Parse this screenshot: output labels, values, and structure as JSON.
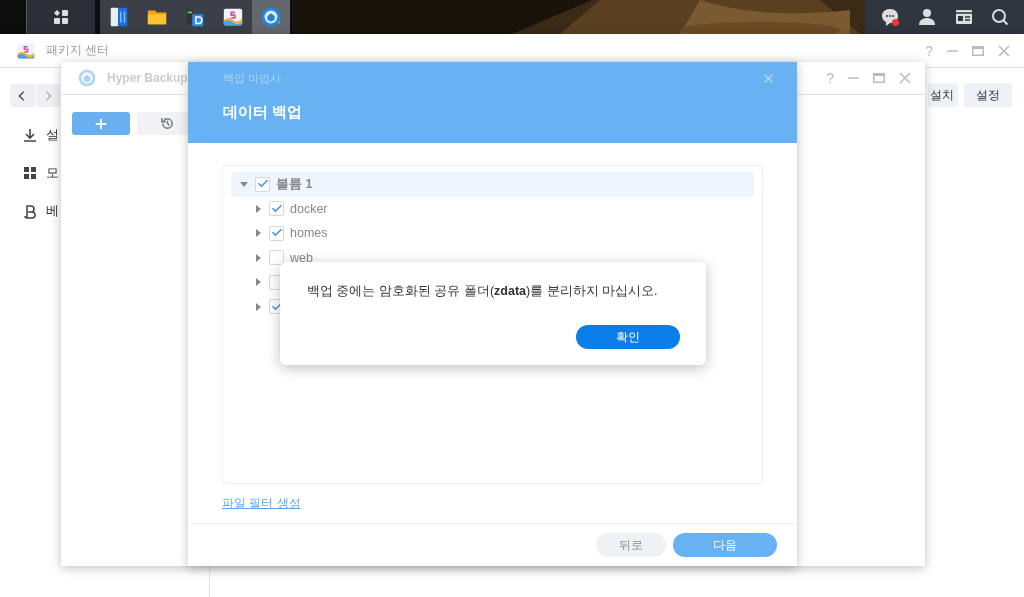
{
  "taskbar": {
    "apps": [
      {
        "kind": "storage",
        "selected": false
      },
      {
        "kind": "folder",
        "selected": false
      },
      {
        "kind": "docs",
        "selected": false
      },
      {
        "kind": "package",
        "selected": false
      },
      {
        "kind": "backup",
        "selected": true
      }
    ],
    "notifications": {
      "unread": true
    }
  },
  "package_center": {
    "title": "패키지 센터",
    "help": "?",
    "sidebar": [
      {
        "kind": "download",
        "label": "설"
      },
      {
        "kind": "grid",
        "label": "모"
      },
      {
        "kind": "beta",
        "label": "베"
      }
    ],
    "buttons": [
      "설치",
      "설정"
    ]
  },
  "hyper_backup": {
    "title": "Hyper Backup",
    "help": "?"
  },
  "wizard": {
    "title": "백업 마법사",
    "heading": "데이터 백업",
    "tree": [
      {
        "label": "볼륨 1",
        "checked": true,
        "expanded": true,
        "selected": true,
        "children": [
          {
            "label": "docker",
            "checked": true,
            "expanded": false,
            "selected": false
          },
          {
            "label": "homes",
            "checked": true,
            "expanded": false,
            "selected": false
          },
          {
            "label": "web",
            "checked": false,
            "expanded": false,
            "selected": false
          },
          {
            "checked": false,
            "expanded": false,
            "selected": false
          },
          {
            "checked": true,
            "expanded": false,
            "selected": false
          }
        ]
      }
    ],
    "link": "파일 필터 생성",
    "buttons": [
      {
        "label": "뒤로",
        "kind": "secondary"
      },
      {
        "label": "다음",
        "kind": "primary"
      }
    ]
  },
  "alert": {
    "message": "백업 중에는 암호화된 공유 폴더(**zdata**)를 분리하지 마십시오.",
    "button": "확인"
  }
}
